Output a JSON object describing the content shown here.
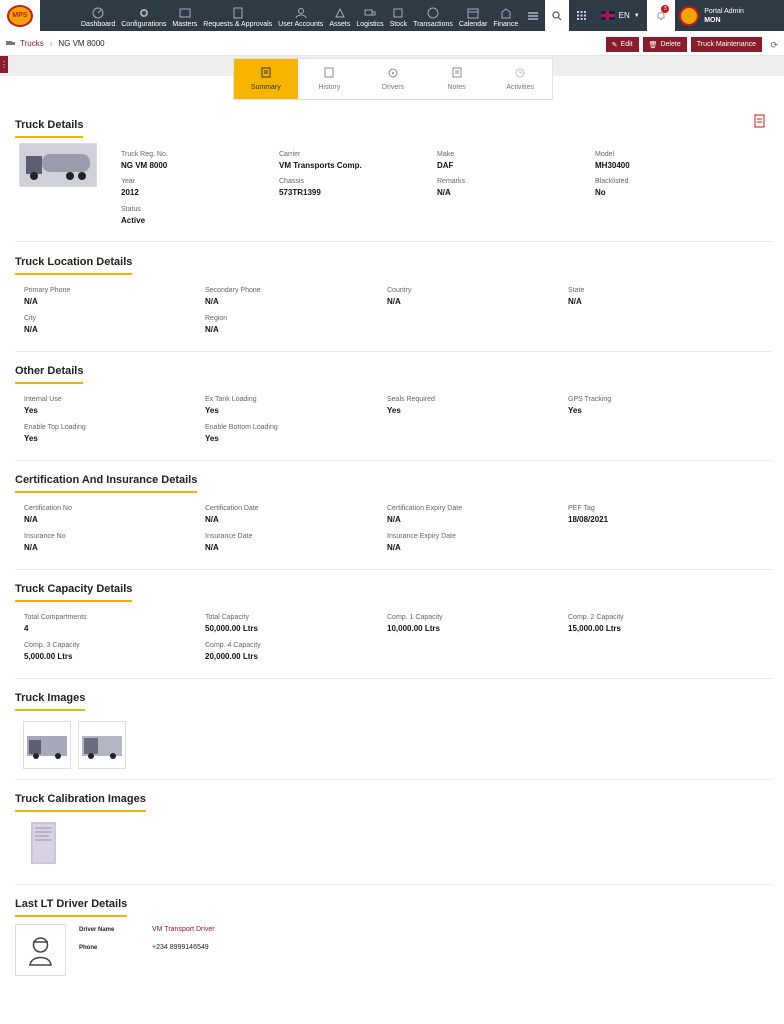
{
  "app": {
    "logo_text": "MPS"
  },
  "nav": [
    {
      "label": "Dashboard",
      "icon": "dashboard-icon"
    },
    {
      "label": "Configurations",
      "icon": "configurations-icon"
    },
    {
      "label": "Masters",
      "icon": "masters-icon"
    },
    {
      "label": "Requests & Approvals",
      "icon": "requests-icon"
    },
    {
      "label": "User Accounts",
      "icon": "user-accounts-icon"
    },
    {
      "label": "Assets",
      "icon": "assets-icon"
    },
    {
      "label": "Logistics",
      "icon": "logistics-icon"
    },
    {
      "label": "Stock",
      "icon": "stock-icon"
    },
    {
      "label": "Transactions",
      "icon": "transactions-icon"
    },
    {
      "label": "Calendar",
      "icon": "calendar-icon"
    },
    {
      "label": "Finance",
      "icon": "finance-icon"
    }
  ],
  "topbar": {
    "language": "EN",
    "notifications": "3",
    "user_name": "Portal Admin",
    "user_org": "MON"
  },
  "breadcrumb": {
    "section": "Trucks",
    "current": "NG VM 8000"
  },
  "actions": {
    "edit": "Edit",
    "delete": "Delete",
    "maintenance": "Truck Maintenance"
  },
  "tabs": [
    {
      "label": "Summary",
      "active": true
    },
    {
      "label": "History",
      "active": false
    },
    {
      "label": "Drivers",
      "active": false
    },
    {
      "label": "Notes",
      "active": false
    },
    {
      "label": "Activities",
      "active": false
    }
  ],
  "truck_details": {
    "title": "Truck Details",
    "fields": [
      {
        "label": "Truck Reg. No.",
        "value": "NG VM 8000"
      },
      {
        "label": "Carrier",
        "value": "VM Transports Comp."
      },
      {
        "label": "Make",
        "value": "DAF"
      },
      {
        "label": "Model",
        "value": "MH30400"
      },
      {
        "label": "Year",
        "value": "2012"
      },
      {
        "label": "Chassis",
        "value": "573TR1399"
      },
      {
        "label": "Remarks",
        "value": "N/A"
      },
      {
        "label": "Blacklisted",
        "value": "No"
      },
      {
        "label": "Status",
        "value": "Active"
      }
    ]
  },
  "location": {
    "title": "Truck Location Details",
    "fields": [
      {
        "label": "Primary Phone",
        "value": "N/A"
      },
      {
        "label": "Secondary Phone",
        "value": "N/A"
      },
      {
        "label": "Country",
        "value": "N/A"
      },
      {
        "label": "State",
        "value": "N/A"
      },
      {
        "label": "City",
        "value": "N/A"
      },
      {
        "label": "Region",
        "value": "N/A"
      }
    ]
  },
  "other": {
    "title": "Other Details",
    "fields": [
      {
        "label": "Internal Use",
        "value": "Yes"
      },
      {
        "label": "Ex Tank Loading",
        "value": "Yes"
      },
      {
        "label": "Seals Required",
        "value": "Yes"
      },
      {
        "label": "GPS Tracking",
        "value": "Yes"
      },
      {
        "label": "Enable Top Loading",
        "value": "Yes"
      },
      {
        "label": "Enable Bottom Loading",
        "value": "Yes"
      }
    ]
  },
  "certification": {
    "title": "Certification And Insurance Details",
    "fields": [
      {
        "label": "Certification No",
        "value": "N/A"
      },
      {
        "label": "Certification Date",
        "value": "N/A"
      },
      {
        "label": "Certification Expiry Date",
        "value": "N/A"
      },
      {
        "label": "PEF Tag",
        "value": "18/08/2021"
      },
      {
        "label": "Insurance No",
        "value": "N/A"
      },
      {
        "label": "Insurance Date",
        "value": "N/A"
      },
      {
        "label": "Insurance Expiry Date",
        "value": "N/A"
      }
    ]
  },
  "capacity": {
    "title": "Truck Capacity Details",
    "fields": [
      {
        "label": "Total Compartments",
        "value": "4"
      },
      {
        "label": "Total Capacity",
        "value": "50,000.00 Ltrs"
      },
      {
        "label": "Comp. 1 Capacity",
        "value": "10,000.00 Ltrs"
      },
      {
        "label": "Comp. 2 Capacity",
        "value": "15,000.00 Ltrs"
      },
      {
        "label": "Comp. 3 Capacity",
        "value": "5,000.00 Ltrs"
      },
      {
        "label": "Comp. 4 Capacity",
        "value": "20,000.00 Ltrs"
      }
    ]
  },
  "images": {
    "title": "Truck Images"
  },
  "calibration": {
    "title": "Truck Calibration Images"
  },
  "driver": {
    "title": "Last LT Driver Details",
    "name_label": "Driver Name",
    "name_value": "VM Transport Driver",
    "phone_label": "Phone",
    "phone_value": "+234 8999146549"
  },
  "colors": {
    "brand": "#8a1c2b",
    "accent": "#f7b500",
    "topbar": "#2e3a44"
  }
}
